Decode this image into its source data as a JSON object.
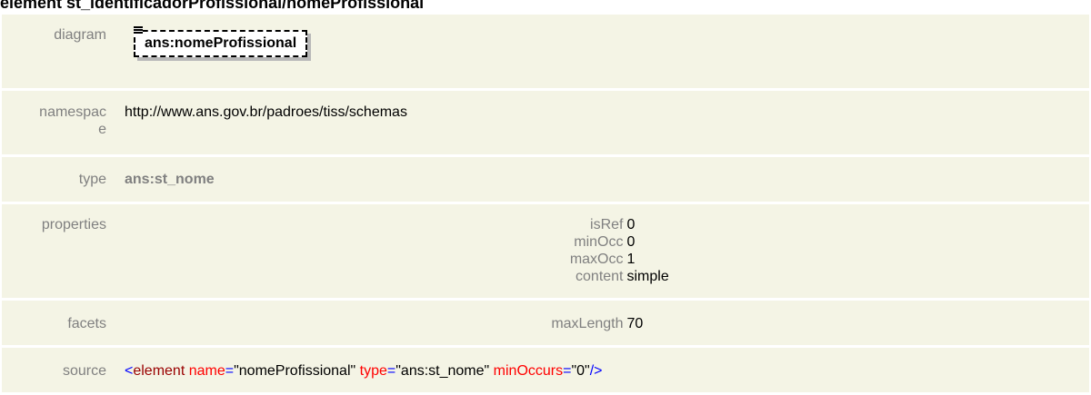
{
  "page": {
    "title": "element st_identificadorProfissional/nomeProfissional"
  },
  "rows": {
    "diagram": {
      "label": "diagram",
      "node_label": "ans:nomeProfissional",
      "node_icon": "element-list-icon"
    },
    "namespace": {
      "label_line1": "namespac",
      "label_line2": "e",
      "value": "http://www.ans.gov.br/padroes/tiss/schemas"
    },
    "type": {
      "label": "type",
      "value": "ans:st_nome"
    },
    "properties": {
      "label": "properties",
      "items": [
        {
          "key": "isRef",
          "value": "0"
        },
        {
          "key": "minOcc",
          "value": "0"
        },
        {
          "key": "maxOcc",
          "value": "1"
        },
        {
          "key": "content",
          "value": "simple"
        }
      ]
    },
    "facets": {
      "label": "facets",
      "key": "maxLength",
      "value": "70"
    },
    "source": {
      "label": "source",
      "open": "<",
      "tag": "element",
      "attr1_name": "name",
      "eq": "=",
      "attr1_value": "\"nomeProfissional\"",
      "attr2_name": "type",
      "attr2_value": "\"ans:st_nome\"",
      "attr3_name": "minOccurs",
      "attr3_value": "\"0\"",
      "close": "/>"
    }
  },
  "colors": {
    "row_background": "#f4f4e5",
    "label_text": "#808080",
    "xml_tag": "#990000",
    "xml_attribute": "#ff0000",
    "xml_punctuation": "#0000ff"
  }
}
